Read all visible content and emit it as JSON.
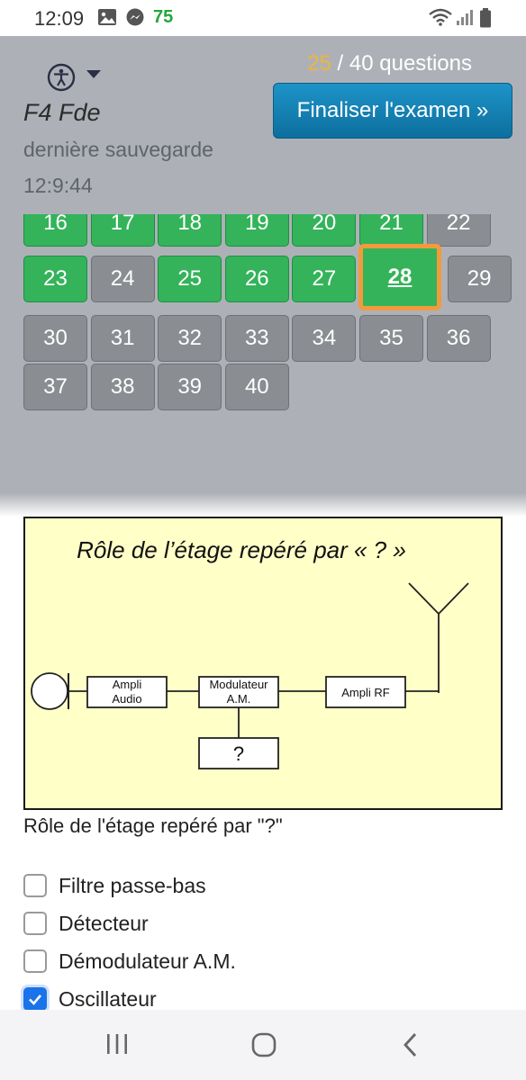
{
  "status_bar": {
    "time": "12:09",
    "notification_count": "75"
  },
  "header": {
    "callsign": "F4 Fde",
    "saved_label": "dernière sauvegarde",
    "saved_time": "12:9:44",
    "progress_current": "25",
    "progress_rest": " / 40 questions",
    "finalize_label": "Finaliser l'examen »"
  },
  "grid": {
    "answered_color": "#34b35a",
    "todo_color": "#8a8d91",
    "current_border_color": "#f39a3c",
    "cells": [
      {
        "n": "16",
        "state": "answered"
      },
      {
        "n": "17",
        "state": "answered"
      },
      {
        "n": "18",
        "state": "answered"
      },
      {
        "n": "19",
        "state": "answered"
      },
      {
        "n": "20",
        "state": "answered"
      },
      {
        "n": "21",
        "state": "answered"
      },
      {
        "n": "22",
        "state": "todo"
      },
      {
        "n": "23",
        "state": "answered"
      },
      {
        "n": "24",
        "state": "todo"
      },
      {
        "n": "25",
        "state": "answered"
      },
      {
        "n": "26",
        "state": "answered"
      },
      {
        "n": "27",
        "state": "answered"
      },
      {
        "n": "28",
        "state": "current"
      },
      {
        "n": "29",
        "state": "todo"
      },
      {
        "n": "30",
        "state": "todo"
      },
      {
        "n": "31",
        "state": "todo"
      },
      {
        "n": "32",
        "state": "todo"
      },
      {
        "n": "33",
        "state": "todo"
      },
      {
        "n": "34",
        "state": "todo"
      },
      {
        "n": "35",
        "state": "todo"
      },
      {
        "n": "36",
        "state": "todo"
      },
      {
        "n": "37",
        "state": "todo"
      },
      {
        "n": "38",
        "state": "todo"
      },
      {
        "n": "39",
        "state": "todo"
      },
      {
        "n": "40",
        "state": "todo"
      }
    ]
  },
  "diagram": {
    "title": "Rôle de l’étage repéré par « ? »",
    "block_ampli_audio_1": "Ampli",
    "block_ampli_audio_2": "Audio",
    "block_modulateur_1": "Modulateur",
    "block_modulateur_2": "A.M.",
    "block_ampli_rf": "Ampli RF",
    "block_unknown": "?",
    "background_color": "#ffffc8"
  },
  "question": {
    "text": "Rôle de l'étage repéré par \"?\""
  },
  "options": [
    {
      "label": "Filtre passe-bas",
      "checked": false
    },
    {
      "label": "Détecteur",
      "checked": false
    },
    {
      "label": "Démodulateur A.M.",
      "checked": false
    },
    {
      "label": "Oscillateur",
      "checked": true
    }
  ]
}
